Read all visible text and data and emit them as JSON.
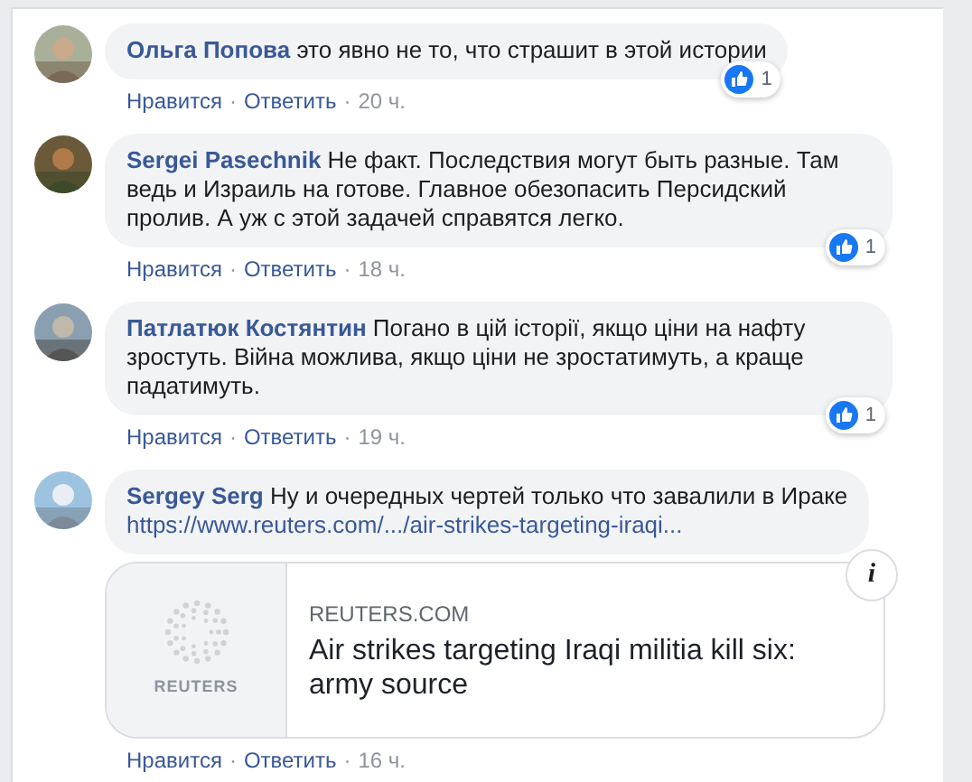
{
  "comments": [
    {
      "author": "Ольга Попова",
      "text": "это явно не то, что страшит в этой истории",
      "likes": "1",
      "footer": [
        {
          "kind": "link",
          "text": "Нравится"
        },
        {
          "kind": "dot",
          "text": "·"
        },
        {
          "kind": "link",
          "text": "Ответить"
        },
        {
          "kind": "dot",
          "text": "·"
        },
        {
          "kind": "time",
          "text": "20 ч."
        }
      ]
    },
    {
      "author": "Sergei Pasechnik",
      "text": "Не факт. Последствия могут быть разные. Там ведь и Израиль на готове. Главное обезопасить Персидский пролив. А уж с этой задачей справятся легко.",
      "likes": "1",
      "footer": [
        {
          "kind": "link",
          "text": "Нравится"
        },
        {
          "kind": "dot",
          "text": "·"
        },
        {
          "kind": "link",
          "text": "Ответить"
        },
        {
          "kind": "dot",
          "text": "·"
        },
        {
          "kind": "time",
          "text": "18 ч."
        }
      ]
    },
    {
      "author": "Патлатюк Костянтин",
      "text": "Погано в цій історії, якщо ціни на нафту зростуть. Війна можлива, якщо ціни не зростатимуть, а краще падатимуть.",
      "likes": "1",
      "footer": [
        {
          "kind": "link",
          "text": "Нравится"
        },
        {
          "kind": "dot",
          "text": "·"
        },
        {
          "kind": "link",
          "text": "Ответить"
        },
        {
          "kind": "dot",
          "text": "·"
        },
        {
          "kind": "time",
          "text": "19 ч."
        }
      ]
    },
    {
      "author": "Sergey Serg",
      "text": "Ну и очередных чертей только что завалили в Ираке",
      "link": "https://www.reuters.com/.../air-strikes-targeting-iraqi...",
      "preview": {
        "logo_text": "REUTERS",
        "domain": "REUTERS.COM",
        "title": "Air strikes targeting Iraqi militia kill six: army source",
        "info": "i"
      },
      "footer": [
        {
          "kind": "link",
          "text": "Нравится"
        },
        {
          "kind": "dot",
          "text": "·"
        },
        {
          "kind": "link",
          "text": "Ответить"
        },
        {
          "kind": "dot",
          "text": "·"
        },
        {
          "kind": "time",
          "text": "16 ч."
        }
      ]
    }
  ]
}
